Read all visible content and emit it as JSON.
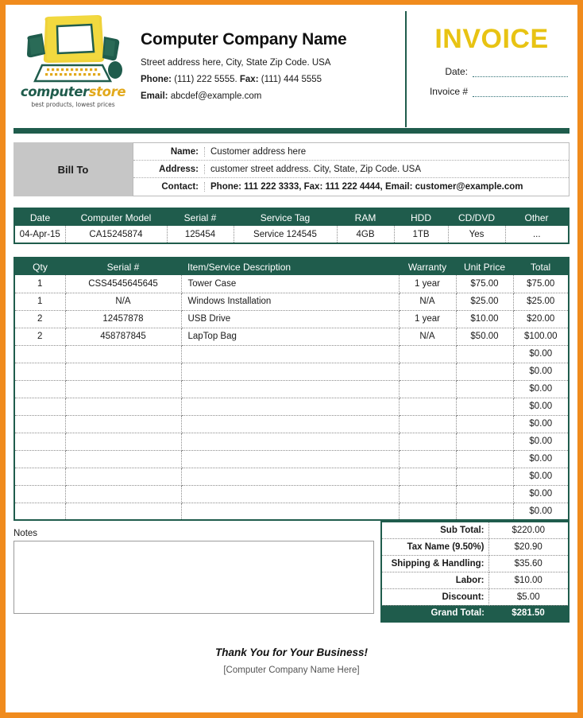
{
  "theme": {
    "border_orange": "#F08B1D",
    "dark_green": "#1F5C4C",
    "invoice_gold": "#E8C313",
    "billto_gray": "#C6C6C6"
  },
  "header": {
    "logo": {
      "word_part1": "computer",
      "word_part2": "store",
      "tagline": "best products, lowest prices",
      "icon_name": "computer-monitor-logo"
    },
    "company_name": "Computer Company Name",
    "address_line": "Street address here, City, State Zip Code. USA",
    "phone_label": "Phone:",
    "phone_value": "(111) 222 5555.",
    "fax_label": "Fax:",
    "fax_value": "(111) 444 5555",
    "email_label": "Email:",
    "email_value": "abcdef@example.com",
    "invoice_title": "INVOICE",
    "date_label": "Date:",
    "date_value": "",
    "invoice_no_label": "Invoice #",
    "invoice_no_value": ""
  },
  "bill_to": {
    "section_label": "Bill To",
    "rows": [
      {
        "key": "Name:",
        "value": "Customer address here",
        "bold": false
      },
      {
        "key": "Address:",
        "value": "customer street address. City, State, Zip Code. USA",
        "bold": false
      },
      {
        "key": "Contact:",
        "value": "Phone: 111 222 3333, Fax: 111 222 4444, Email: customer@example.com",
        "bold": true
      }
    ]
  },
  "specs_table": {
    "headers": [
      "Date",
      "Computer Model",
      "Serial #",
      "Service Tag",
      "RAM",
      "HDD",
      "CD/DVD",
      "Other"
    ],
    "rows": [
      [
        "04-Apr-15",
        "CA15245874",
        "125454",
        "Service 124545",
        "4GB",
        "1TB",
        "Yes",
        "..."
      ]
    ]
  },
  "items_table": {
    "headers": [
      "Qty",
      "Serial #",
      "Item/Service Description",
      "Warranty",
      "Unit Price",
      "Total"
    ],
    "rows": [
      {
        "qty": "1",
        "serial": "CSS4545645645",
        "description": "Tower Case",
        "warranty": "1 year",
        "unit_price": "$75.00",
        "total": "$75.00"
      },
      {
        "qty": "1",
        "serial": "N/A",
        "description": "Windows Installation",
        "warranty": "N/A",
        "unit_price": "$25.00",
        "total": "$25.00"
      },
      {
        "qty": "2",
        "serial": "12457878",
        "description": "USB Drive",
        "warranty": "1 year",
        "unit_price": "$10.00",
        "total": "$20.00"
      },
      {
        "qty": "2",
        "serial": "458787845",
        "description": "LapTop Bag",
        "warranty": "N/A",
        "unit_price": "$50.00",
        "total": "$100.00"
      },
      {
        "qty": "",
        "serial": "",
        "description": "",
        "warranty": "",
        "unit_price": "",
        "total": "$0.00"
      },
      {
        "qty": "",
        "serial": "",
        "description": "",
        "warranty": "",
        "unit_price": "",
        "total": "$0.00"
      },
      {
        "qty": "",
        "serial": "",
        "description": "",
        "warranty": "",
        "unit_price": "",
        "total": "$0.00"
      },
      {
        "qty": "",
        "serial": "",
        "description": "",
        "warranty": "",
        "unit_price": "",
        "total": "$0.00"
      },
      {
        "qty": "",
        "serial": "",
        "description": "",
        "warranty": "",
        "unit_price": "",
        "total": "$0.00"
      },
      {
        "qty": "",
        "serial": "",
        "description": "",
        "warranty": "",
        "unit_price": "",
        "total": "$0.00"
      },
      {
        "qty": "",
        "serial": "",
        "description": "",
        "warranty": "",
        "unit_price": "",
        "total": "$0.00"
      },
      {
        "qty": "",
        "serial": "",
        "description": "",
        "warranty": "",
        "unit_price": "",
        "total": "$0.00"
      },
      {
        "qty": "",
        "serial": "",
        "description": "",
        "warranty": "",
        "unit_price": "",
        "total": "$0.00"
      },
      {
        "qty": "",
        "serial": "",
        "description": "",
        "warranty": "",
        "unit_price": "",
        "total": "$0.00"
      }
    ]
  },
  "notes": {
    "label": "Notes",
    "value": "",
    "placeholder": ""
  },
  "totals": {
    "rows": [
      {
        "label": "Sub Total:",
        "value": "$220.00"
      },
      {
        "label": "Tax Name (9.50%)",
        "value": "$20.90"
      },
      {
        "label": "Shipping & Handling:",
        "value": "$35.60"
      },
      {
        "label": "Labor:",
        "value": "$10.00"
      },
      {
        "label": "Discount:",
        "value": "$5.00"
      }
    ],
    "grand": {
      "label": "Grand Total:",
      "value": "$281.50"
    }
  },
  "footer": {
    "thanks": "Thank You for Your Business!",
    "company_placeholder": "[Computer Company Name Here]"
  }
}
